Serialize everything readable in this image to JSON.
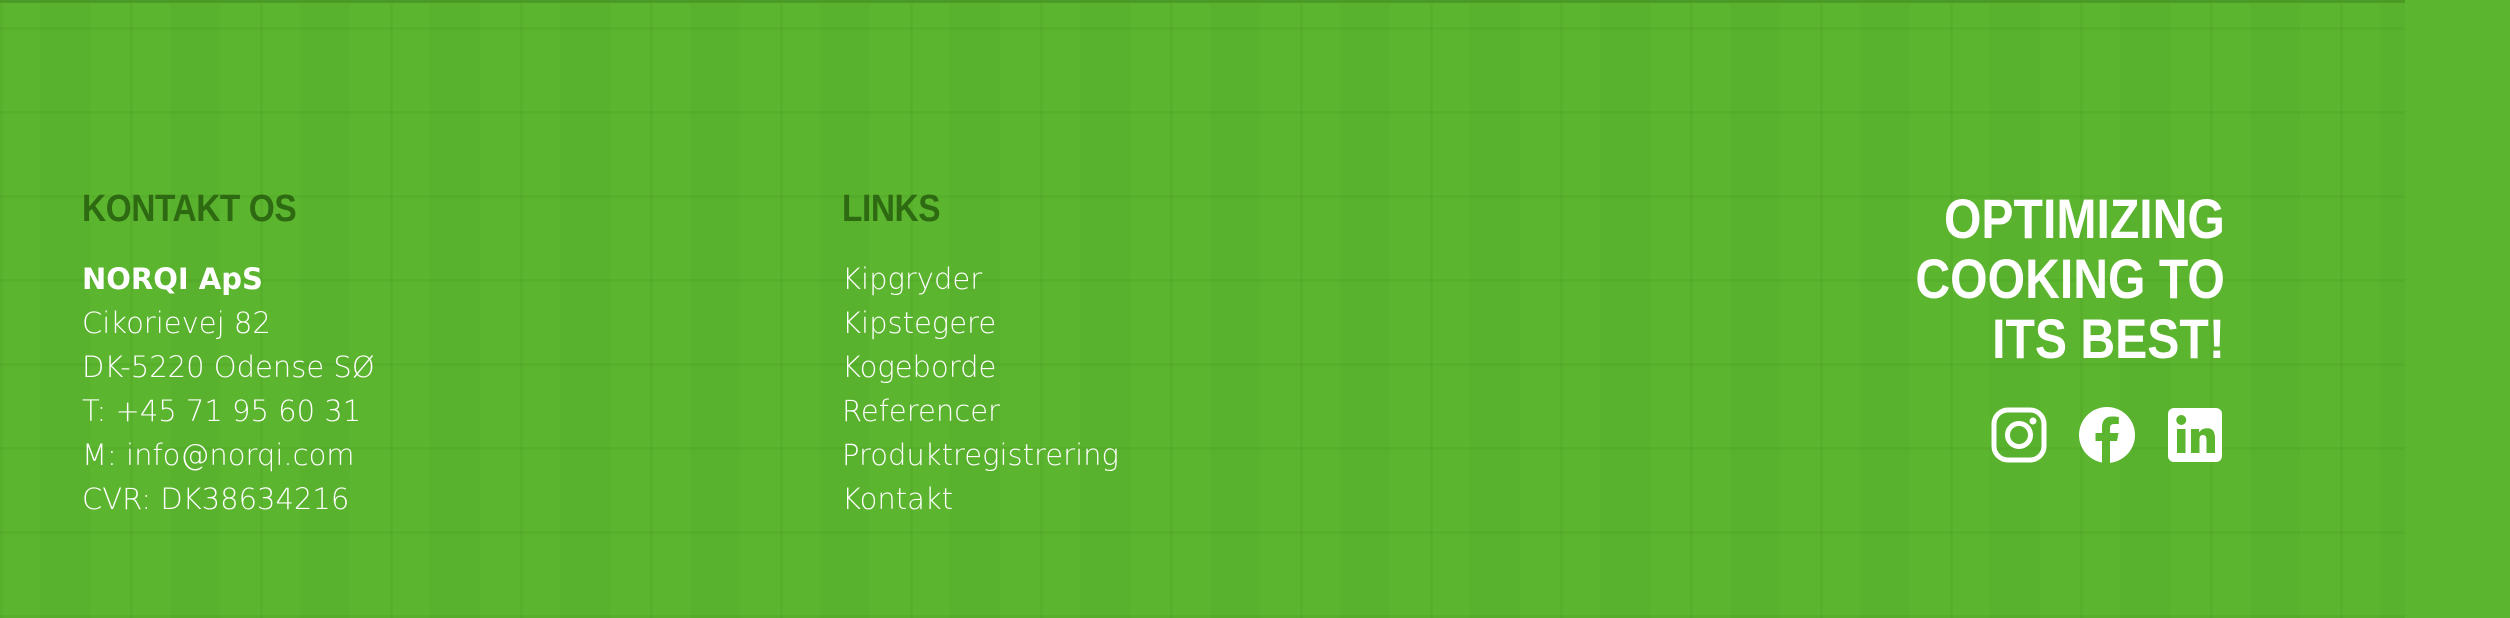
{
  "contact": {
    "heading": "KONTAKT OS",
    "company": "NORQI ApS",
    "address_line": "Cikorievej 82",
    "city_line": "DK-5220 Odense SØ",
    "phone_line": "T: +45 71 95 60 31",
    "email_line": "M: info@norqi.com",
    "cvr_line": "CVR: DK38634216"
  },
  "links": {
    "heading": "LINKS",
    "items": [
      {
        "label": "Kipgryder"
      },
      {
        "label": "Kipstegere"
      },
      {
        "label": "Kogeborde"
      },
      {
        "label": "Referencer"
      },
      {
        "label": "Produktregistrering"
      },
      {
        "label": "Kontakt"
      }
    ]
  },
  "slogan": {
    "line1": "OPTIMIZING",
    "line2": "COOKING TO",
    "line3": "ITS BEST!"
  },
  "social": {
    "icons": [
      "instagram-icon",
      "facebook-icon",
      "linkedin-icon"
    ]
  },
  "colors": {
    "background": "#5cb52f",
    "heading": "#2d6a12",
    "text": "#ffffff"
  }
}
